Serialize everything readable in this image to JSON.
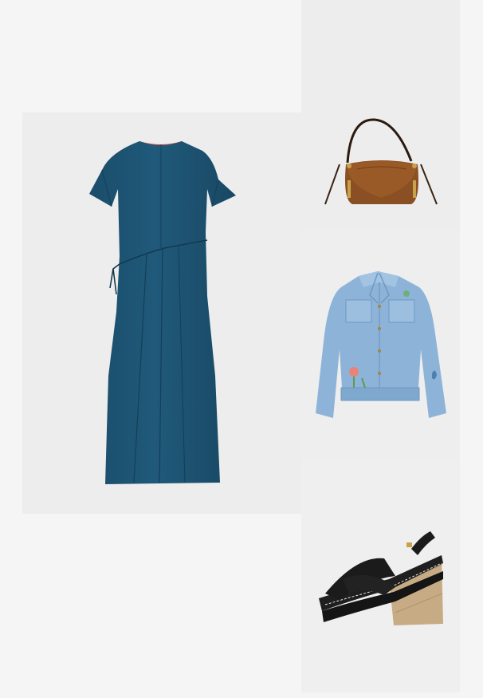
{
  "outfit": {
    "products": [
      {
        "id": "dress",
        "icon": "midi-dress-image",
        "color": "#1e5574"
      },
      {
        "id": "bag",
        "icon": "saddle-bag-image",
        "color": "#8a4f22"
      },
      {
        "id": "jacket",
        "icon": "denim-jacket-image",
        "color": "#8db4d8"
      },
      {
        "id": "shoes",
        "icon": "wedge-sandals-image",
        "color": "#1d1d1d"
      }
    ]
  },
  "colors": {
    "page_background": "#f5f5f5",
    "panel_background": "#ededed"
  }
}
